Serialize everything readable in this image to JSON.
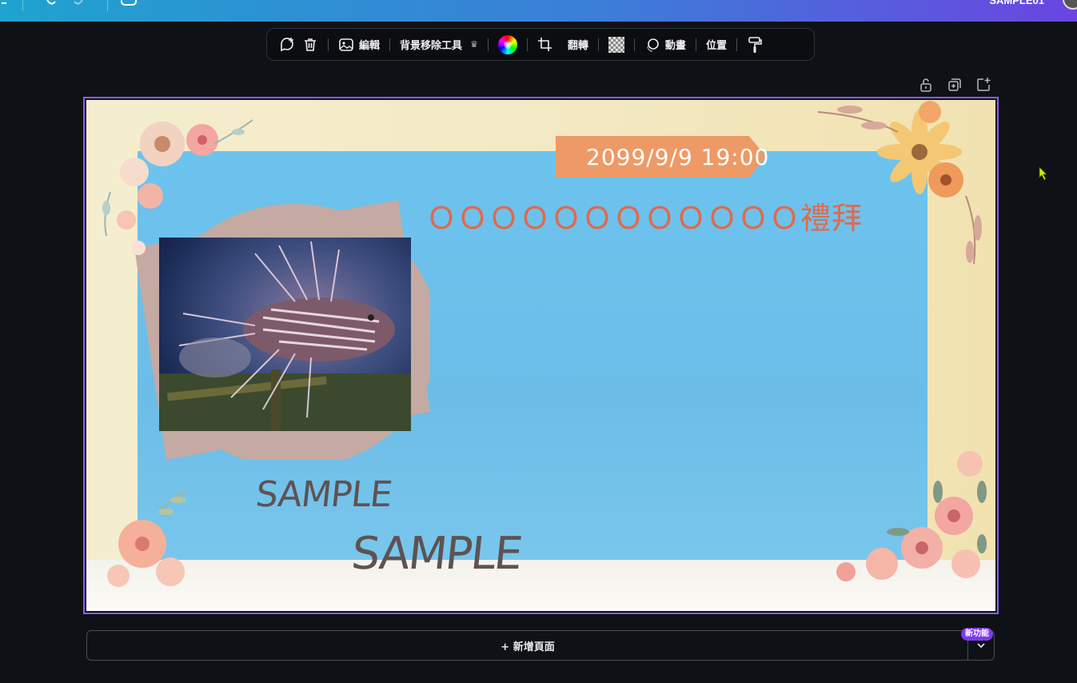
{
  "topbar": {
    "user_name": "SAMPLE01"
  },
  "toolbar": {
    "edit_label": "編輯",
    "bg_remove_label": "背景移除工具",
    "flip_label": "翻轉",
    "animate_label": "動畫",
    "position_label": "位置"
  },
  "design": {
    "date_text": "2099/9/9  19:00",
    "event_title": "ＯＯＯＯＯＯＯＯＯＯＯＯ禮拜",
    "sample_text_1": "SAMPLE",
    "sample_text_2": "SAMPLE"
  },
  "footer": {
    "add_page_label": "+ 新增頁面",
    "new_feature_badge": "新功能"
  },
  "colors": {
    "accent": "#8b5cf6",
    "banner": "#ed9a67",
    "title": "#e06a4c",
    "sky": "#6cc4ee"
  }
}
